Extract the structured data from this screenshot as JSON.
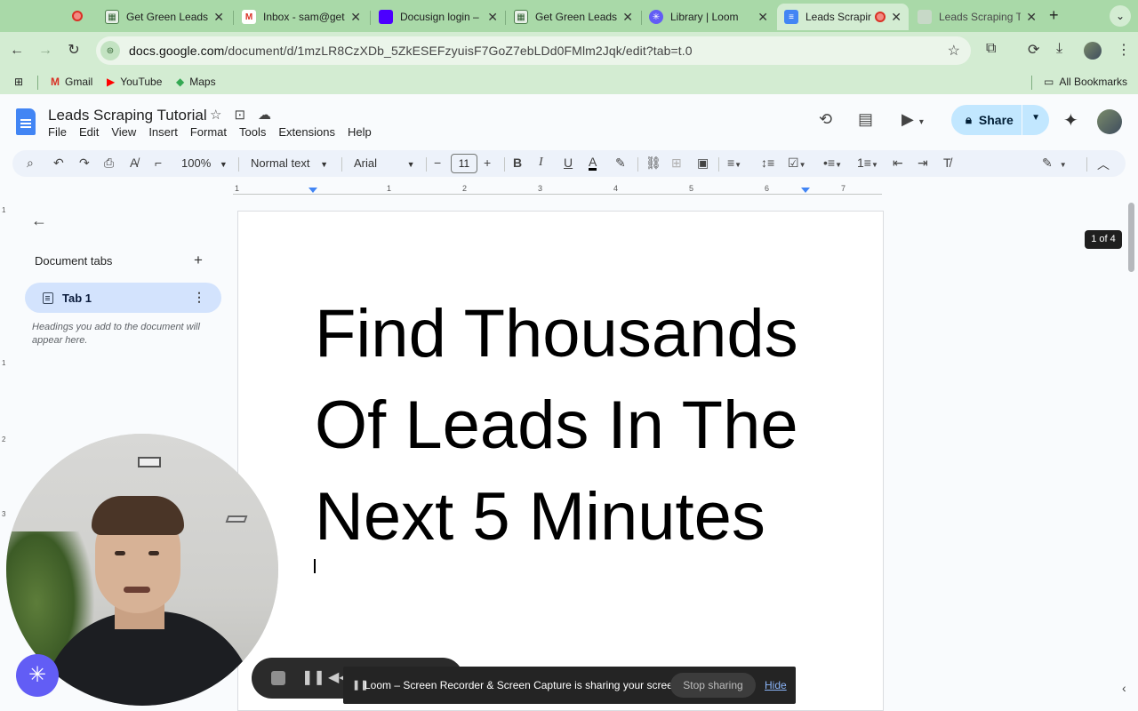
{
  "browser": {
    "tabs": [
      {
        "title": "Get Green Leads",
        "active": false
      },
      {
        "title": "Inbox - sam@getg",
        "active": false
      },
      {
        "title": "Docusign login – ",
        "active": false
      },
      {
        "title": "Get Green Leads",
        "active": false
      },
      {
        "title": "Library | Loom",
        "active": false
      },
      {
        "title": "Leads Scrapin",
        "active": true
      },
      {
        "title": "Leads Scraping T",
        "active": false
      }
    ],
    "url_host": "docs.google.com",
    "url_path": "/document/d/1mzLR8CzXDb_5ZkESEFzyuisF7GoZ7ebLDd0FMlm2Jqk/edit?tab=t.0",
    "bookmarks": [
      {
        "label": "Gmail",
        "icon": "gmail-icon"
      },
      {
        "label": "YouTube",
        "icon": "youtube-icon"
      },
      {
        "label": "Maps",
        "icon": "maps-icon"
      }
    ],
    "all_bookmarks": "All Bookmarks"
  },
  "docs": {
    "title": "Leads Scraping Tutorial",
    "menu": [
      "File",
      "Edit",
      "View",
      "Insert",
      "Format",
      "Tools",
      "Extensions",
      "Help"
    ],
    "share_label": "Share",
    "toolbar": {
      "zoom": "100%",
      "style": "Normal text",
      "font": "Arial",
      "font_size": "11"
    },
    "ruler_numbers": [
      "1",
      "1",
      "2",
      "3",
      "4",
      "5",
      "6",
      "7"
    ],
    "vruler_numbers": [
      "1",
      "1",
      "2",
      "3"
    ]
  },
  "sidebar": {
    "heading": "Document tabs",
    "tab_label": "Tab 1",
    "hint": "Headings you add to the document will appear here."
  },
  "document": {
    "headline_lines": [
      "Find Thousands",
      "Of Leads In The",
      "Next 5 Minutes"
    ]
  },
  "page_counter": "1 of 4",
  "loom": {
    "share_message": "Loom – Screen Recorder & Screen Capture is sharing your screen.",
    "stop_label": "Stop sharing",
    "hide_label": "Hide"
  },
  "colors": {
    "chrome_theme": "#a9d9a8",
    "toolbar_bg": "#d3ecd2",
    "docs_blue": "#4285f4",
    "share_bg": "#c2e7ff",
    "tab_pill": "#d3e3fd",
    "loom_purple": "#625df5"
  }
}
